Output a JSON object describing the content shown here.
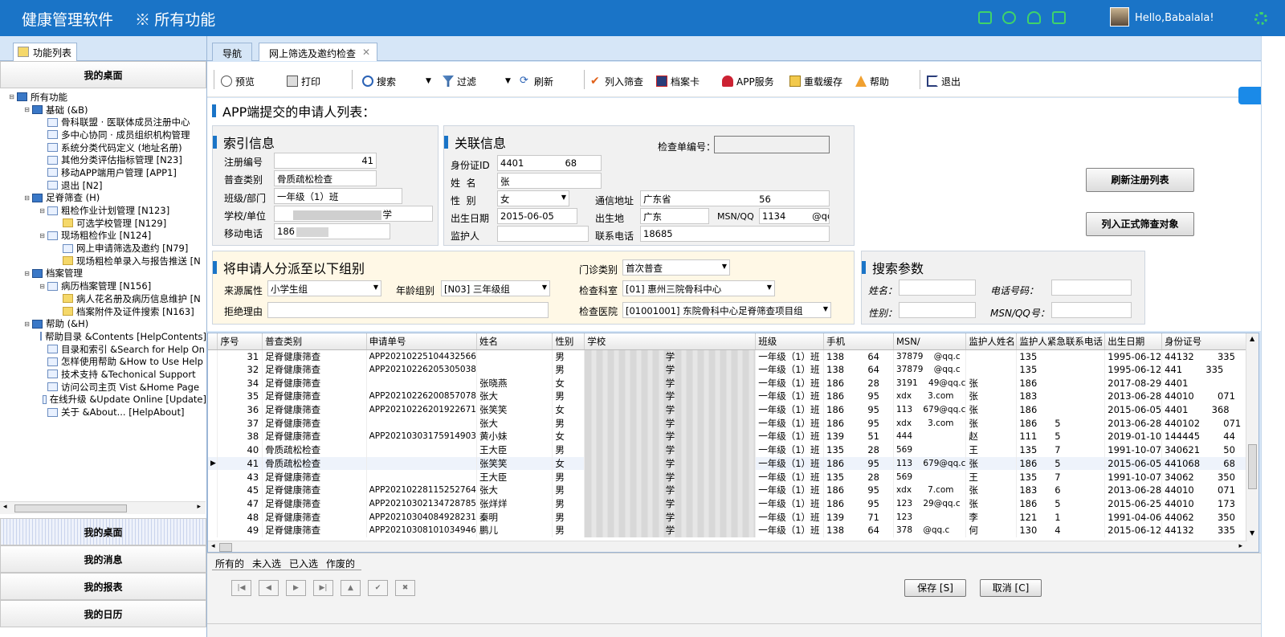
{
  "app": {
    "title": "健康管理软件",
    "module": "※ 所有功能",
    "greeting": "Hello,Babalala!"
  },
  "colors": {
    "topbar": "#1a74c7",
    "accent_icons": "#3fd36a"
  },
  "left": {
    "tab": "功能列表",
    "desk_top": "我的桌面",
    "bottom": [
      "我的桌面",
      "我的消息",
      "我的报表",
      "我的日历"
    ]
  },
  "tree": [
    {
      "lvl": 0,
      "tog": "⊟",
      "ic": "d",
      "t": "所有功能"
    },
    {
      "lvl": 1,
      "tog": "⊟",
      "ic": "d",
      "t": "基础 (&B)"
    },
    {
      "lvl": 2,
      "tog": "",
      "ic": "",
      "t": "骨科联盟 · 医联体成员注册中心"
    },
    {
      "lvl": 2,
      "tog": "",
      "ic": "",
      "t": "多中心协同 · 成员组织机构管理"
    },
    {
      "lvl": 2,
      "tog": "",
      "ic": "",
      "t": "系统分类代码定义 (地址名册)"
    },
    {
      "lvl": 2,
      "tog": "",
      "ic": "",
      "t": "其他分类评估指标管理 [N23]"
    },
    {
      "lvl": 2,
      "tog": "",
      "ic": "",
      "t": "移动APP端用户管理 [APP1]"
    },
    {
      "lvl": 2,
      "tog": "",
      "ic": "",
      "t": "退出 [N2]"
    },
    {
      "lvl": 1,
      "tog": "⊟",
      "ic": "d",
      "t": "足脊筛查 (H)"
    },
    {
      "lvl": 2,
      "tog": "⊟",
      "ic": "",
      "t": "粗检作业计划管理 [N123]"
    },
    {
      "lvl": 3,
      "tog": "",
      "ic": "f",
      "t": "可选学校管理 [N129]"
    },
    {
      "lvl": 2,
      "tog": "⊟",
      "ic": "",
      "t": "现场粗检作业 [N124]"
    },
    {
      "lvl": 3,
      "tog": "",
      "ic": "",
      "t": "网上申请筛选及邀约 [N79]"
    },
    {
      "lvl": 3,
      "tog": "",
      "ic": "f",
      "t": "现场粗检单录入与报告推送 [N"
    },
    {
      "lvl": 1,
      "tog": "⊟",
      "ic": "d",
      "t": "档案管理"
    },
    {
      "lvl": 2,
      "tog": "⊟",
      "ic": "",
      "t": "病历档案管理 [N156]"
    },
    {
      "lvl": 3,
      "tog": "",
      "ic": "f",
      "t": "病人花名册及病历信息维护 [N"
    },
    {
      "lvl": 3,
      "tog": "",
      "ic": "f",
      "t": "档案附件及证件搜索 [N163]"
    },
    {
      "lvl": 1,
      "tog": "⊟",
      "ic": "d",
      "t": "帮助 (&H)"
    },
    {
      "lvl": 2,
      "tog": "",
      "ic": "",
      "t": "帮助目录 &Contents [HelpContents]"
    },
    {
      "lvl": 2,
      "tog": "",
      "ic": "",
      "t": "目录和索引 &Search for Help On"
    },
    {
      "lvl": 2,
      "tog": "",
      "ic": "",
      "t": "怎样使用帮助 &How to Use Help"
    },
    {
      "lvl": 2,
      "tog": "",
      "ic": "",
      "t": "技术支持 &Techonical Support"
    },
    {
      "lvl": 2,
      "tog": "",
      "ic": "",
      "t": "访问公司主页 Vist &Home Page"
    },
    {
      "lvl": 2,
      "tog": "",
      "ic": "",
      "t": "在线升级 &Update Online [Update]"
    },
    {
      "lvl": 2,
      "tog": "",
      "ic": "",
      "t": "关于 &About... [HelpAbout]"
    }
  ],
  "tabs": {
    "nav": "导航",
    "active": "网上筛选及邀约检查"
  },
  "toolbar": {
    "preview": "预览",
    "print": "打印",
    "search": "搜索",
    "filter": "过滤",
    "refresh": "刷新",
    "add_screen": "列入筛查",
    "card": "档案卡",
    "app_service": "APP服务",
    "reload": "重载缓存",
    "help": "帮助",
    "exit": "退出"
  },
  "page": {
    "title": "APP端提交的申请人列表："
  },
  "index": {
    "title": "索引信息",
    "reg_no_label": "注册编号",
    "reg_no": "41",
    "type_label": "普查类别",
    "type": "骨质疏松检查",
    "class_label": "班级/部门",
    "class": "一年级（1）班",
    "school_label": "学校/单位",
    "school": "学",
    "mobile_label": "移动电话",
    "mobile": "186"
  },
  "related": {
    "title": "关联信息",
    "check_no_label": "检查单编号：",
    "check_no": "",
    "id_label": "身份证ID",
    "id": "4401              68",
    "name_label": "姓  名",
    "name": "张",
    "gender_label": "性  别",
    "gender": "女",
    "addr_label": "通信地址",
    "addr": "广东省                              56",
    "birth_label": "出生日期",
    "birth": "2015-06-05",
    "birthplace_label": "出生地",
    "birthplace": "广东",
    "msn_label": "MSN/QQ",
    "msn": "1134         @qq",
    "guardian_label": "监护人",
    "guardian": "",
    "contact_label": "联系电话",
    "contact": "18685"
  },
  "buttons": {
    "refresh_list": "刷新注册列表",
    "add_formal": "列入正式筛查对象",
    "save": "保存 [S]",
    "cancel": "取消 [C]"
  },
  "assign": {
    "title": "将申请人分派至以下组别",
    "source_label": "来源属性",
    "source": "小学生组",
    "age_label": "年龄组别",
    "age": "[N03] 三年级组",
    "reject_label": "拒绝理由",
    "reject": "",
    "clinic_label": "门诊类别",
    "clinic": "首次普查",
    "dept_label": "检查科室",
    "dept": "[01] 惠州三院骨科中心",
    "hospital_label": "检查医院",
    "hospital": "[01001001] 东院骨科中心足脊筛查项目组"
  },
  "search": {
    "title": "搜索参数",
    "name_label": "姓名：",
    "phone_label": "电话号码：",
    "gender_label": "性别：",
    "msn_label": "MSN/QQ号："
  },
  "grid": {
    "columns": [
      "序号",
      "普查类别",
      "申请单号",
      "姓名",
      "性别",
      "学校",
      "班级",
      "手机",
      "MSN/",
      "监护人姓名",
      "监护人紧急联系电话",
      "出生日期",
      "身份证号"
    ],
    "rows": [
      [
        "31",
        "足脊健康筛查",
        "APP20210225104432566",
        "",
        "男",
        "学",
        "一年级（1）班",
        "138        64",
        "37879    @qq.c",
        "",
        "135",
        "1995-06-12",
        "44132        335"
      ],
      [
        "32",
        "足脊健康筛查",
        "APP20210226205305038",
        "",
        "男",
        "学",
        "一年级（1）班",
        "138        64",
        "37879    @qq.c",
        "",
        "135",
        "1995-06-12",
        "441        335"
      ],
      [
        "34",
        "足脊健康筛查",
        "",
        "张晓燕",
        "女",
        "学",
        "一年级（1）班",
        "186        28",
        "3191    49@qq.c",
        "张",
        "186",
        "2017-08-29",
        "4401        "
      ],
      [
        "35",
        "足脊健康筛查",
        "APP20210226200857078",
        "张大",
        "男",
        "学",
        "一年级（1）班",
        "186        95",
        "xdx      3.com",
        "张",
        "183",
        "2013-06-28",
        "44010        071"
      ],
      [
        "36",
        "足脊健康筛查",
        "APP20210226201922671",
        "张笑笑",
        "女",
        "学",
        "一年级（1）班",
        "186        95",
        "113    679@qq.c",
        "张",
        "186",
        "2015-06-05",
        "4401        368"
      ],
      [
        "37",
        "足脊健康筛查",
        "",
        "张大",
        "男",
        "学",
        "一年级（1）班",
        "186        95",
        "xdx      3.com",
        "张",
        "186      5",
        "2013-06-28",
        "440102        071"
      ],
      [
        "38",
        "足脊健康筛查",
        "APP20210303175914903",
        "黄小妹",
        "女",
        "学",
        "一年级（1）班",
        "139        51",
        "444",
        "赵",
        "111      5",
        "2019-01-10",
        "144445        44"
      ],
      [
        "40",
        "骨质疏松检查",
        "",
        "王大臣",
        "男",
        "学",
        "一年级（1）班",
        "135        28",
        "569",
        "王",
        "135      7",
        "1991-10-07",
        "340621        50"
      ],
      [
        "41",
        "骨质疏松检查",
        "",
        "张笑笑",
        "女",
        "学",
        "一年级（1）班",
        "186        95",
        "113    679@qq.c",
        "张",
        "186      5",
        "2015-06-05",
        "441068        68"
      ],
      [
        "43",
        "足脊健康筛查",
        "",
        "王大臣",
        "男",
        "学",
        "一年级（1）班",
        "135        28",
        "569",
        "王",
        "135      7",
        "1991-10-07",
        "34062        350"
      ],
      [
        "45",
        "足脊健康筛查",
        "APP20210228115252764",
        "张大",
        "男",
        "学",
        "一年级（1）班",
        "186        95",
        "xdx      7.com",
        "张",
        "183      6",
        "2013-06-28",
        "44010        071"
      ],
      [
        "47",
        "足脊健康筛查",
        "APP20210302134728785",
        "张烊烊",
        "男",
        "学",
        "一年级（1）班",
        "186        95",
        "123    29@qq.c",
        "张",
        "186      5",
        "2015-06-25",
        "44010        173"
      ],
      [
        "48",
        "足脊健康筛查",
        "APP20210304084928231",
        "秦明",
        "男",
        "学",
        "一年级（1）班",
        "139        71",
        "123",
        "李",
        "121      1",
        "1991-04-06",
        "44062        350"
      ],
      [
        "49",
        "足脊健康筛查",
        "APP20210308101034946",
        "鹏儿",
        "男",
        "学",
        "一年级（1）班",
        "138        64",
        "378    @qq.c",
        "何",
        "130      4",
        "2015-06-12",
        "44132        335"
      ]
    ],
    "current_row": 8
  },
  "filters": [
    "所有的",
    "未入选",
    "已入选",
    "作废的"
  ]
}
